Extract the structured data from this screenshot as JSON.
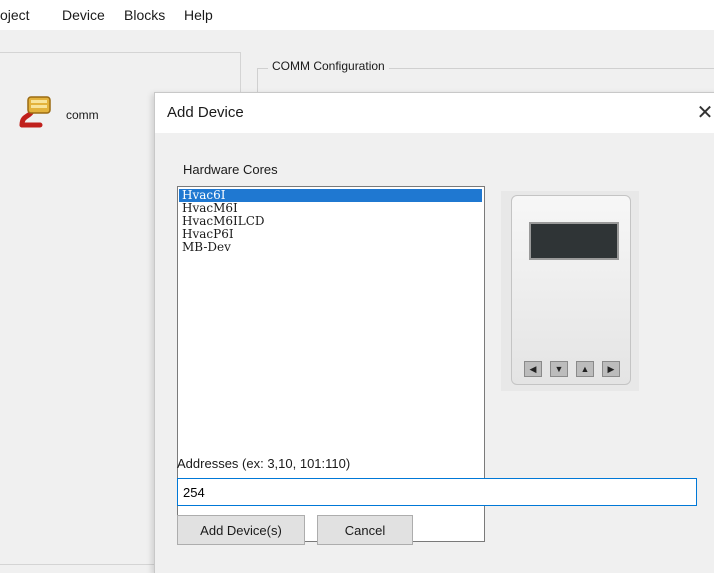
{
  "menubar": {
    "items": [
      "oject",
      "Device",
      "Blocks",
      "Help"
    ]
  },
  "tree": {
    "node_label": "comm",
    "node_icon": "serial-connector-icon"
  },
  "group": {
    "title": "COMM Configuration"
  },
  "dialog": {
    "title": "Add Device",
    "close_glyph": "✕",
    "section_label": "Hardware Cores",
    "cores": [
      "Hvac6I",
      "HvacM6I",
      "HvacM6ILCD",
      "HvacP6I",
      "MB-Dev"
    ],
    "selected_core": "Hvac6I",
    "device_image_icon": "hvac-controller-device-icon",
    "device_keys": [
      "◀",
      "▼",
      "▲",
      "▶"
    ],
    "addresses_label": "Addresses (ex: 3,10, 101:110)",
    "addresses_value": "254",
    "add_button": "Add Device(s)",
    "cancel_button": "Cancel"
  },
  "colors": {
    "selection": "#1f78d1",
    "input_focus_border": "#0078d7",
    "dialog_bg": "#f0f0f0"
  }
}
